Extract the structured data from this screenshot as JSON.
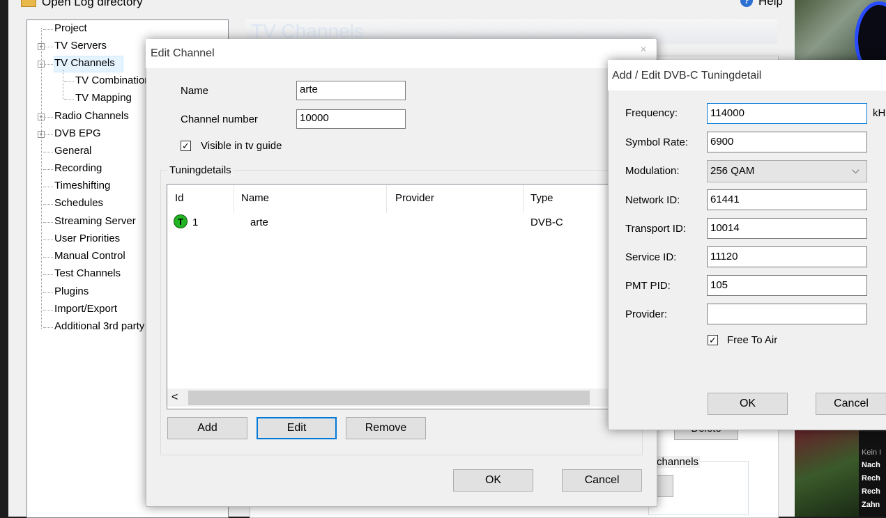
{
  "background": {
    "open_log": "Open Log directory",
    "help": "Help",
    "tree": [
      {
        "label": "Project",
        "level": 0,
        "expander": ""
      },
      {
        "label": "TV Servers",
        "level": 0,
        "expander": "+"
      },
      {
        "label": "TV Channels",
        "level": 0,
        "expander": "−"
      },
      {
        "label": "TV Combinations",
        "level": 1,
        "expander": ""
      },
      {
        "label": "TV Mapping",
        "level": 1,
        "expander": ""
      },
      {
        "label": "Radio Channels",
        "level": 0,
        "expander": "+"
      },
      {
        "label": "DVB EPG",
        "level": 0,
        "expander": "+"
      },
      {
        "label": "General",
        "level": 0,
        "expander": ""
      },
      {
        "label": "Recording",
        "level": 0,
        "expander": ""
      },
      {
        "label": "Timeshifting",
        "level": 0,
        "expander": ""
      },
      {
        "label": "Schedules",
        "level": 0,
        "expander": ""
      },
      {
        "label": "Streaming Server",
        "level": 0,
        "expander": ""
      },
      {
        "label": "User Priorities",
        "level": 0,
        "expander": ""
      },
      {
        "label": "Manual Control",
        "level": 0,
        "expander": ""
      },
      {
        "label": "Test Channels",
        "level": 0,
        "expander": ""
      },
      {
        "label": "Plugins",
        "level": 0,
        "expander": ""
      },
      {
        "label": "Import/Export",
        "level": 0,
        "expander": ""
      },
      {
        "label": "Additional 3rd party",
        "level": 0,
        "expander": ""
      }
    ],
    "selected_tree_item": "TV Channels",
    "pane_title": "TV Channels",
    "delete_label": "Delete",
    "channels_group": "channels",
    "news": [
      "Kein I",
      "Nach",
      "Rech",
      "Rech",
      "Zahn"
    ]
  },
  "edit_channel": {
    "title": "Edit Channel",
    "name_label": "Name",
    "name_value": "arte",
    "number_label": "Channel number",
    "number_value": "10000",
    "visible_label": "Visible in tv guide",
    "visible_checked": true,
    "tuning_group": "Tuningdetails",
    "columns": [
      "Id",
      "Name",
      "Provider",
      "Type"
    ],
    "rows": [
      {
        "icon": "T",
        "id": "1",
        "name": "arte",
        "provider": "",
        "type": "DVB-C"
      }
    ],
    "scroll_left": "<",
    "add": "Add",
    "edit": "Edit",
    "remove": "Remove",
    "ok": "OK",
    "cancel": "Cancel"
  },
  "dvbc": {
    "title": "Add / Edit DVB-C Tuningdetail",
    "frequency_label": "Frequency:",
    "frequency": "114000",
    "frequency_unit": "kH",
    "symbol_rate_label": "Symbol Rate:",
    "symbol_rate": "6900",
    "modulation_label": "Modulation:",
    "modulation": "256 QAM",
    "network_id_label": "Network ID:",
    "network_id": "61441",
    "transport_id_label": "Transport ID:",
    "transport_id": "10014",
    "service_id_label": "Service ID:",
    "service_id": "11120",
    "pmt_pid_label": "PMT PID:",
    "pmt_pid": "105",
    "provider_label": "Provider:",
    "provider": "",
    "fta_label": "Free To Air",
    "fta_checked": true,
    "ok": "OK",
    "cancel": "Cancel"
  }
}
